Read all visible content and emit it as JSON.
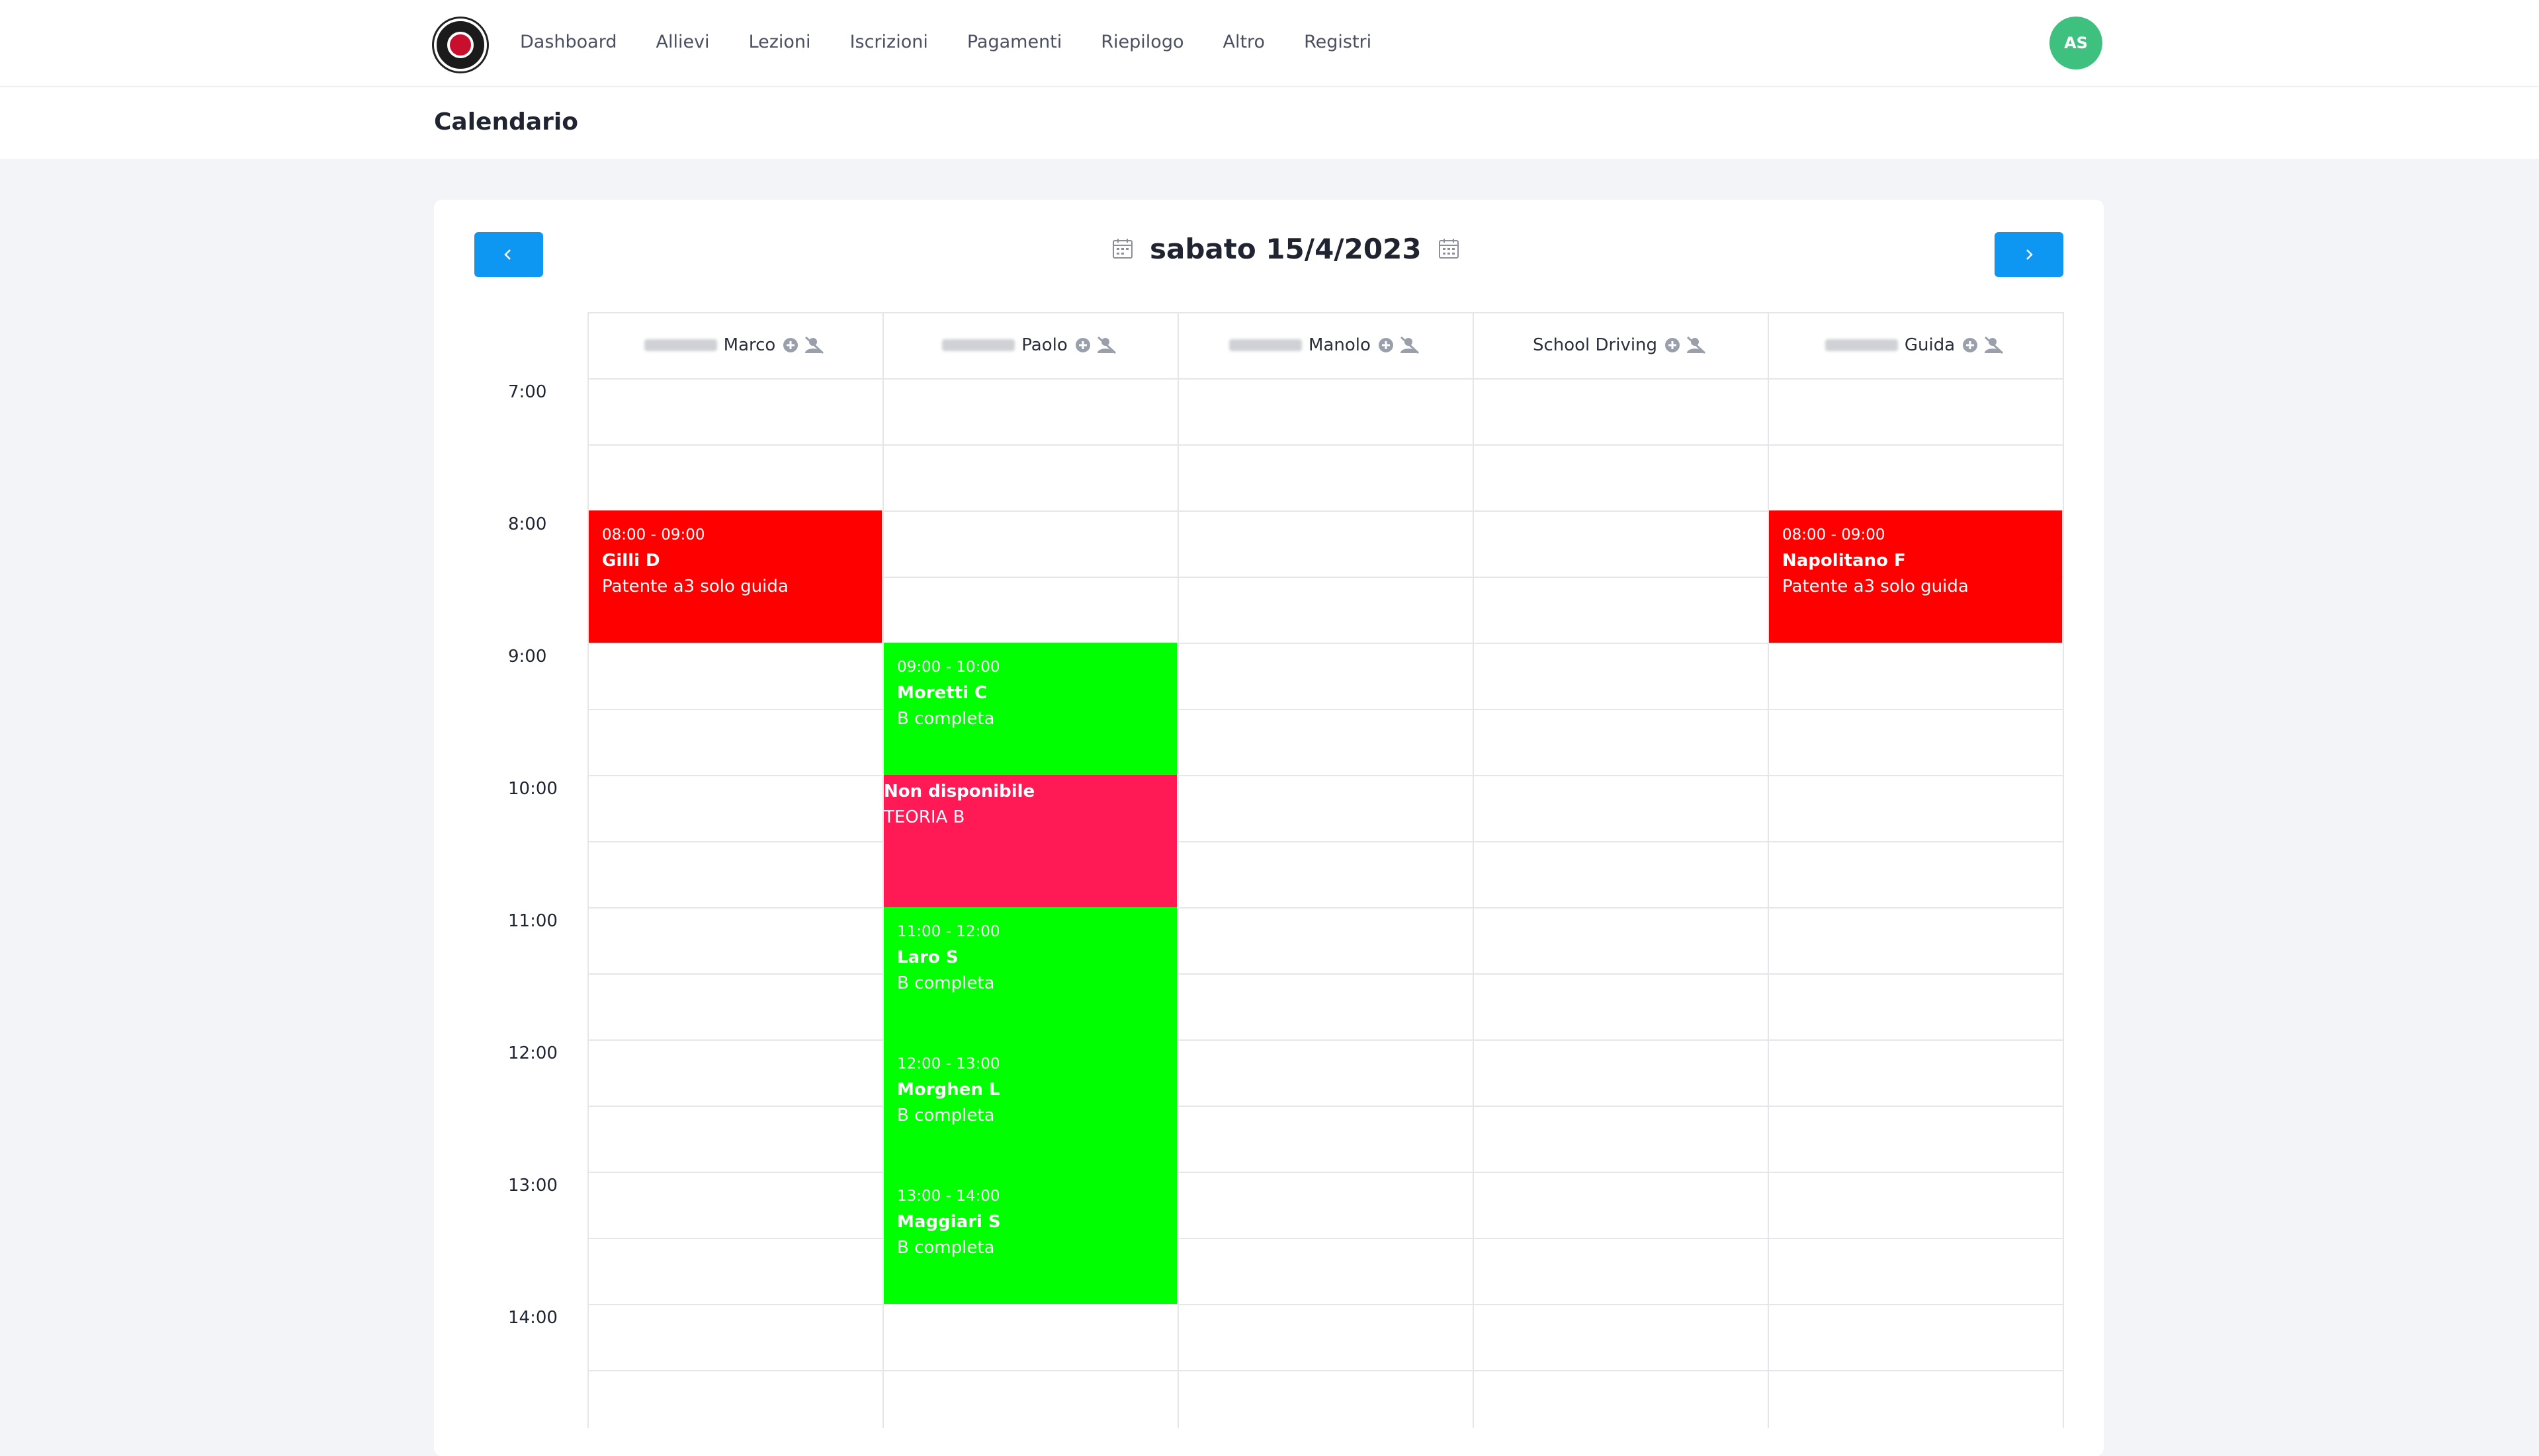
{
  "nav": {
    "items": [
      "Dashboard",
      "Allievi",
      "Lezioni",
      "Iscrizioni",
      "Pagamenti",
      "Riepilogo",
      "Altro",
      "Registri"
    ],
    "avatar_initials": "AS"
  },
  "page": {
    "title": "Calendario"
  },
  "calendar": {
    "date": "sabato 15/4/2023",
    "columns": [
      {
        "name": "Marco"
      },
      {
        "name": "Paolo"
      },
      {
        "name": "Manolo"
      },
      {
        "name": "School Driving"
      },
      {
        "name": "Guida"
      }
    ],
    "hours": [
      "7:00",
      "8:00",
      "9:00",
      "10:00",
      "11:00",
      "12:00",
      "13:00",
      "14:00"
    ],
    "events": [
      {
        "col": 0,
        "start": 8,
        "end": 9,
        "time": "08:00 - 09:00",
        "name": "Gilli D",
        "desc": "Patente a3 solo guida",
        "color": "#ff0000"
      },
      {
        "col": 4,
        "start": 8,
        "end": 9,
        "time": "08:00 - 09:00",
        "name": "Napolitano F",
        "desc": "Patente a3 solo guida",
        "color": "#ff0000"
      },
      {
        "col": 1,
        "start": 9,
        "end": 10,
        "time": "09:00 - 10:00",
        "name": "Moretti C",
        "desc": "B completa",
        "color": "#00ff00"
      },
      {
        "col": 1,
        "start": 10,
        "end": 11,
        "time": "",
        "name": "Non disponibile",
        "desc": "TEORIA B",
        "color": "#ff1a55"
      },
      {
        "col": 1,
        "start": 11,
        "end": 12,
        "time": "11:00 - 12:00",
        "name": "Laro S",
        "desc": "B completa",
        "color": "#00ff00"
      },
      {
        "col": 1,
        "start": 12,
        "end": 13,
        "time": "12:00 - 13:00",
        "name": "Morghen L",
        "desc": "B completa",
        "color": "#00ff00"
      },
      {
        "col": 1,
        "start": 13,
        "end": 14,
        "time": "13:00 - 14:00",
        "name": "Maggiari S",
        "desc": "B completa",
        "color": "#00ff00"
      }
    ]
  }
}
